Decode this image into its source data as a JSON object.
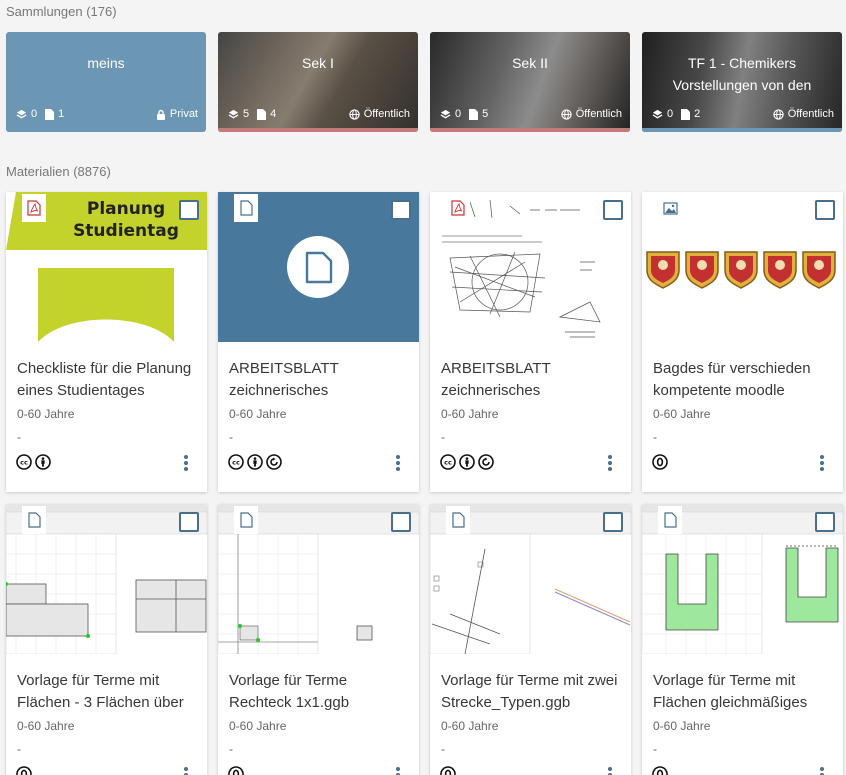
{
  "collections_heading": "Sammlungen (176)",
  "materials_heading": "Materialien (8876)",
  "collections": [
    {
      "title": "meins",
      "subcollections": "0",
      "materials": "1",
      "scope": "Privat",
      "scope_icon": "lock-icon",
      "color": "#6b97b5"
    },
    {
      "title": "Sek I",
      "subcollections": "5",
      "materials": "4",
      "scope": "Öffentlich",
      "scope_icon": "globe-icon",
      "color": "#c27b7b"
    },
    {
      "title": "Sek II",
      "subcollections": "0",
      "materials": "5",
      "scope": "Öffentlich",
      "scope_icon": "globe-icon",
      "color": "#c27b7b"
    },
    {
      "title": "TF 1 - Chemikers Vorstellungen von den",
      "subcollections": "0",
      "materials": "2",
      "scope": "Öffentlich",
      "scope_icon": "globe-icon",
      "color": "#6b97b5"
    }
  ],
  "materials": [
    {
      "title": "Checkliste für die Planung eines Studientages",
      "age": "0-60 Jahre",
      "dash": "-",
      "type_icon": "pdf-icon",
      "licenses": [
        "cc-icon",
        "by-icon"
      ],
      "preview_text": "Planung Studientag"
    },
    {
      "title": "ARBEITSBLATT zeichnerisches",
      "age": "0-60 Jahre",
      "dash": "-",
      "type_icon": "file-icon",
      "licenses": [
        "cc-icon",
        "by-icon",
        "sa-icon"
      ]
    },
    {
      "title": "ARBEITSBLATT zeichnerisches",
      "age": "0-60 Jahre",
      "dash": "-",
      "type_icon": "pdf-icon",
      "licenses": [
        "cc-icon",
        "by-icon",
        "sa-icon"
      ]
    },
    {
      "title": "Bagdes für verschieden kompetente moodle",
      "age": "0-60 Jahre",
      "dash": "-",
      "type_icon": "image-icon",
      "licenses": [
        "cc0-icon"
      ]
    },
    {
      "title": "Vorlage für Terme mit Flächen - 3 Flächen über",
      "age": "0-60 Jahre",
      "dash": "-",
      "type_icon": "file-icon",
      "licenses": [
        "cc0-icon"
      ]
    },
    {
      "title": "Vorlage für Terme Rechteck 1x1.ggb",
      "age": "0-60 Jahre",
      "dash": "-",
      "type_icon": "file-icon",
      "licenses": [
        "cc0-icon"
      ]
    },
    {
      "title": "Vorlage für Terme mit zwei Strecke_Typen.ggb",
      "age": "0-60 Jahre",
      "dash": "-",
      "type_icon": "file-icon",
      "licenses": [
        "cc0-icon"
      ]
    },
    {
      "title": "Vorlage für Terme mit Flächen gleichmäßiges",
      "age": "0-60 Jahre",
      "dash": "-",
      "type_icon": "file-icon",
      "licenses": [
        "cc0-icon"
      ]
    }
  ]
}
